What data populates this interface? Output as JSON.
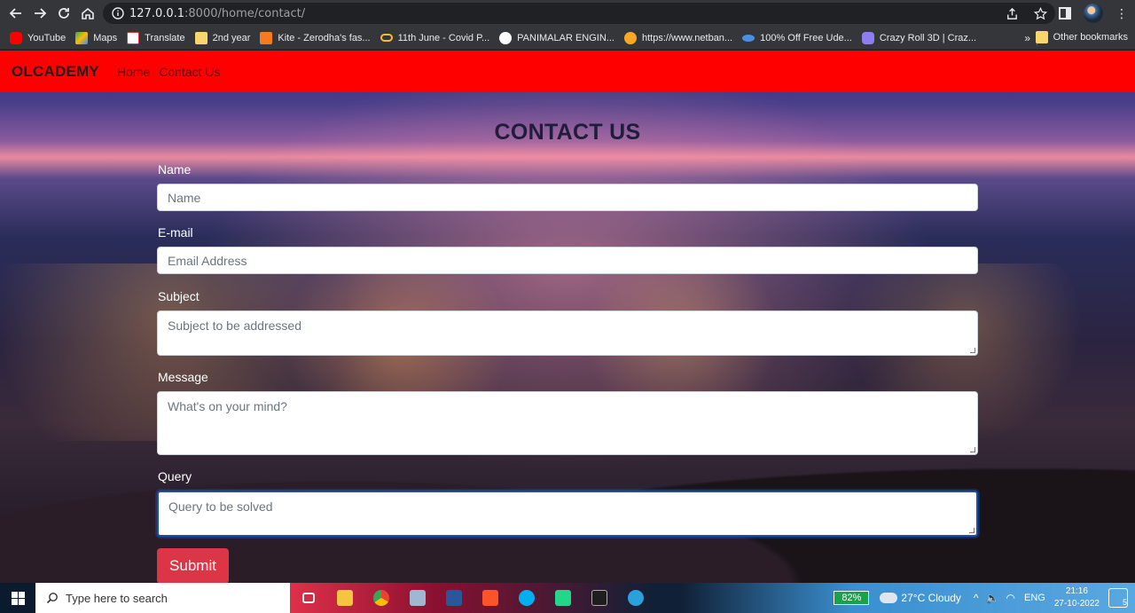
{
  "browser": {
    "url_host": "127.0.0.1",
    "url_rest": ":8000/home/contact/",
    "bookmarks": [
      {
        "label": "YouTube",
        "color": "#ff0000"
      },
      {
        "label": "Maps",
        "color": "#34a853"
      },
      {
        "label": "Translate",
        "color": "#ffffff"
      },
      {
        "label": "2nd year",
        "color": "#f9d56e"
      },
      {
        "label": "Kite - Zerodha's fas...",
        "color": "#f47b20"
      },
      {
        "label": "11th June - Covid P...",
        "color": "#f6b93b"
      },
      {
        "label": "PANIMALAR ENGIN...",
        "color": "#ffffff"
      },
      {
        "label": "https://www.netban...",
        "color": "#f9a825"
      },
      {
        "label": "100% Off Free Ude...",
        "color": "#4a90e2"
      },
      {
        "label": "Crazy Roll 3D | Craz...",
        "color": "#8e7cf0"
      }
    ],
    "other_bookmarks": "Other bookmarks",
    "more": "»"
  },
  "site": {
    "brand": "OLCADEMY",
    "nav": [
      "Home",
      "Contact Us"
    ],
    "title": "CONTACT US",
    "fields": {
      "name": {
        "label": "Name",
        "placeholder": "Name"
      },
      "email": {
        "label": "E-mail",
        "placeholder": "Email Address"
      },
      "subject": {
        "label": "Subject",
        "placeholder": "Subject to be addressed"
      },
      "message": {
        "label": "Message",
        "placeholder": "What's on your mind?"
      },
      "query": {
        "label": "Query",
        "placeholder": "Query to be solved"
      }
    },
    "submit": "Submit",
    "colors": {
      "navbar": "#ff0000",
      "submit": "#dc3545"
    }
  },
  "taskbar": {
    "search_placeholder": "Type here to search",
    "battery": "82%",
    "weather": "27°C  Cloudy",
    "lang": "ENG",
    "time": "21:16",
    "date": "27-10-2022",
    "notifications": "5"
  }
}
